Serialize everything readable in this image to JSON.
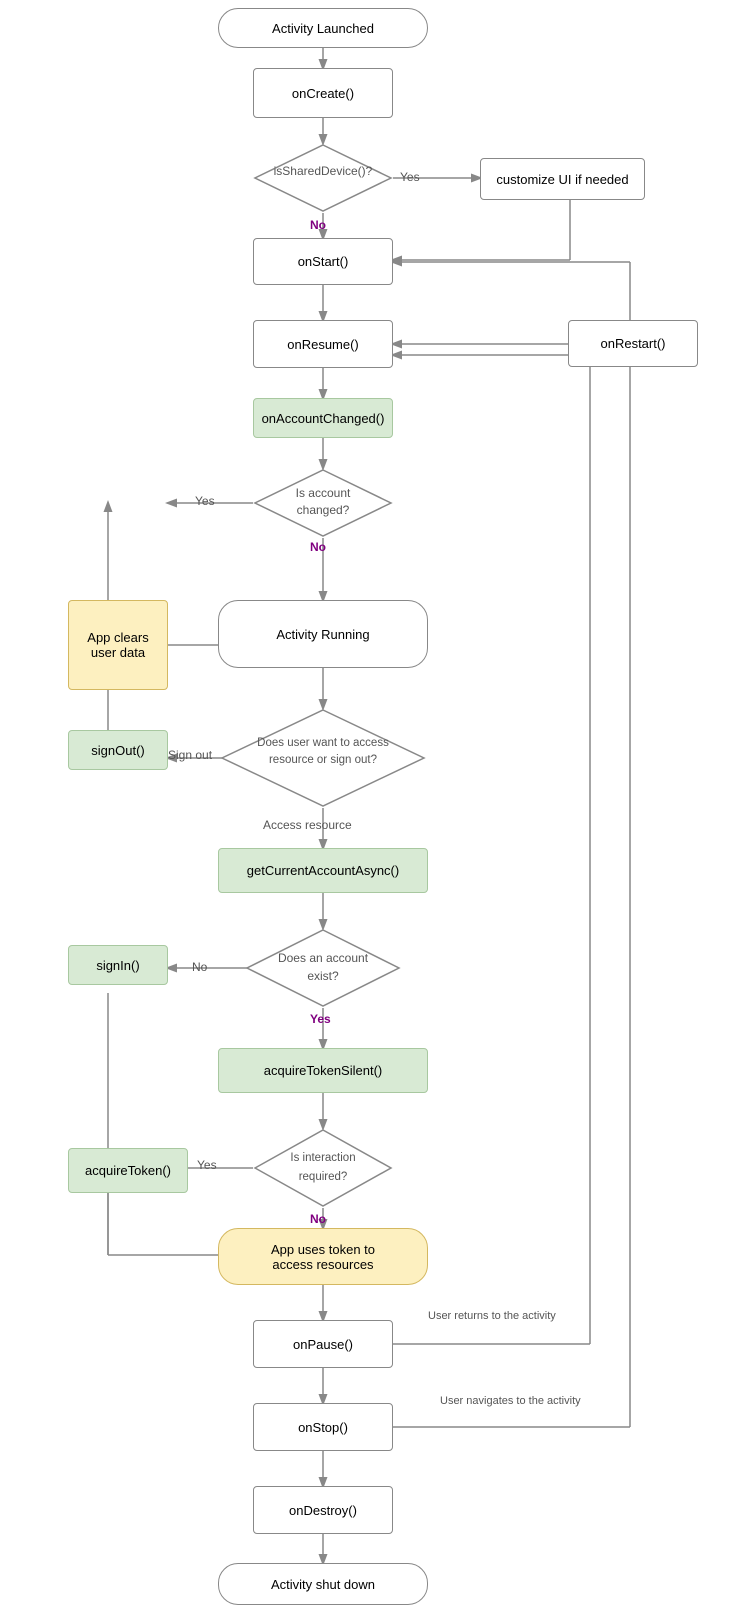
{
  "nodes": {
    "activity_launched": "Activity Launched",
    "onCreate": "onCreate()",
    "isSharedDevice": "isSharedDevice()?",
    "customize_ui": "customize UI if needed",
    "onStart": "onStart()",
    "onRestart": "onRestart()",
    "onResume": "onResume()",
    "onAccountChanged": "onAccountChanged()",
    "is_account_changed": "Is account\nchanged?",
    "app_clears": "App clears\nuser data",
    "activity_running": "Activity Running",
    "does_user_want": "Does user want to access\nresource or sign out?",
    "signOut": "signOut()",
    "getCurrentAccount": "getCurrentAccountAsync()",
    "does_account_exist": "Does an account\nexist?",
    "signIn": "signIn()",
    "acquireTokenSilent": "acquireTokenSilent()",
    "is_interaction_required": "Is interaction\nrequired?",
    "acquireToken": "acquireToken()",
    "app_uses_token": "App uses token to\naccess resources",
    "onPause": "onPause()",
    "onStop": "onStop()",
    "onDestroy": "onDestroy()",
    "activity_shutdown": "Activity shut down"
  },
  "labels": {
    "yes": "Yes",
    "no": "No",
    "sign_out": "Sign out",
    "access_resource": "Access resource",
    "user_returns": "User returns to the activity",
    "user_navigates": "User navigates to the activity"
  }
}
